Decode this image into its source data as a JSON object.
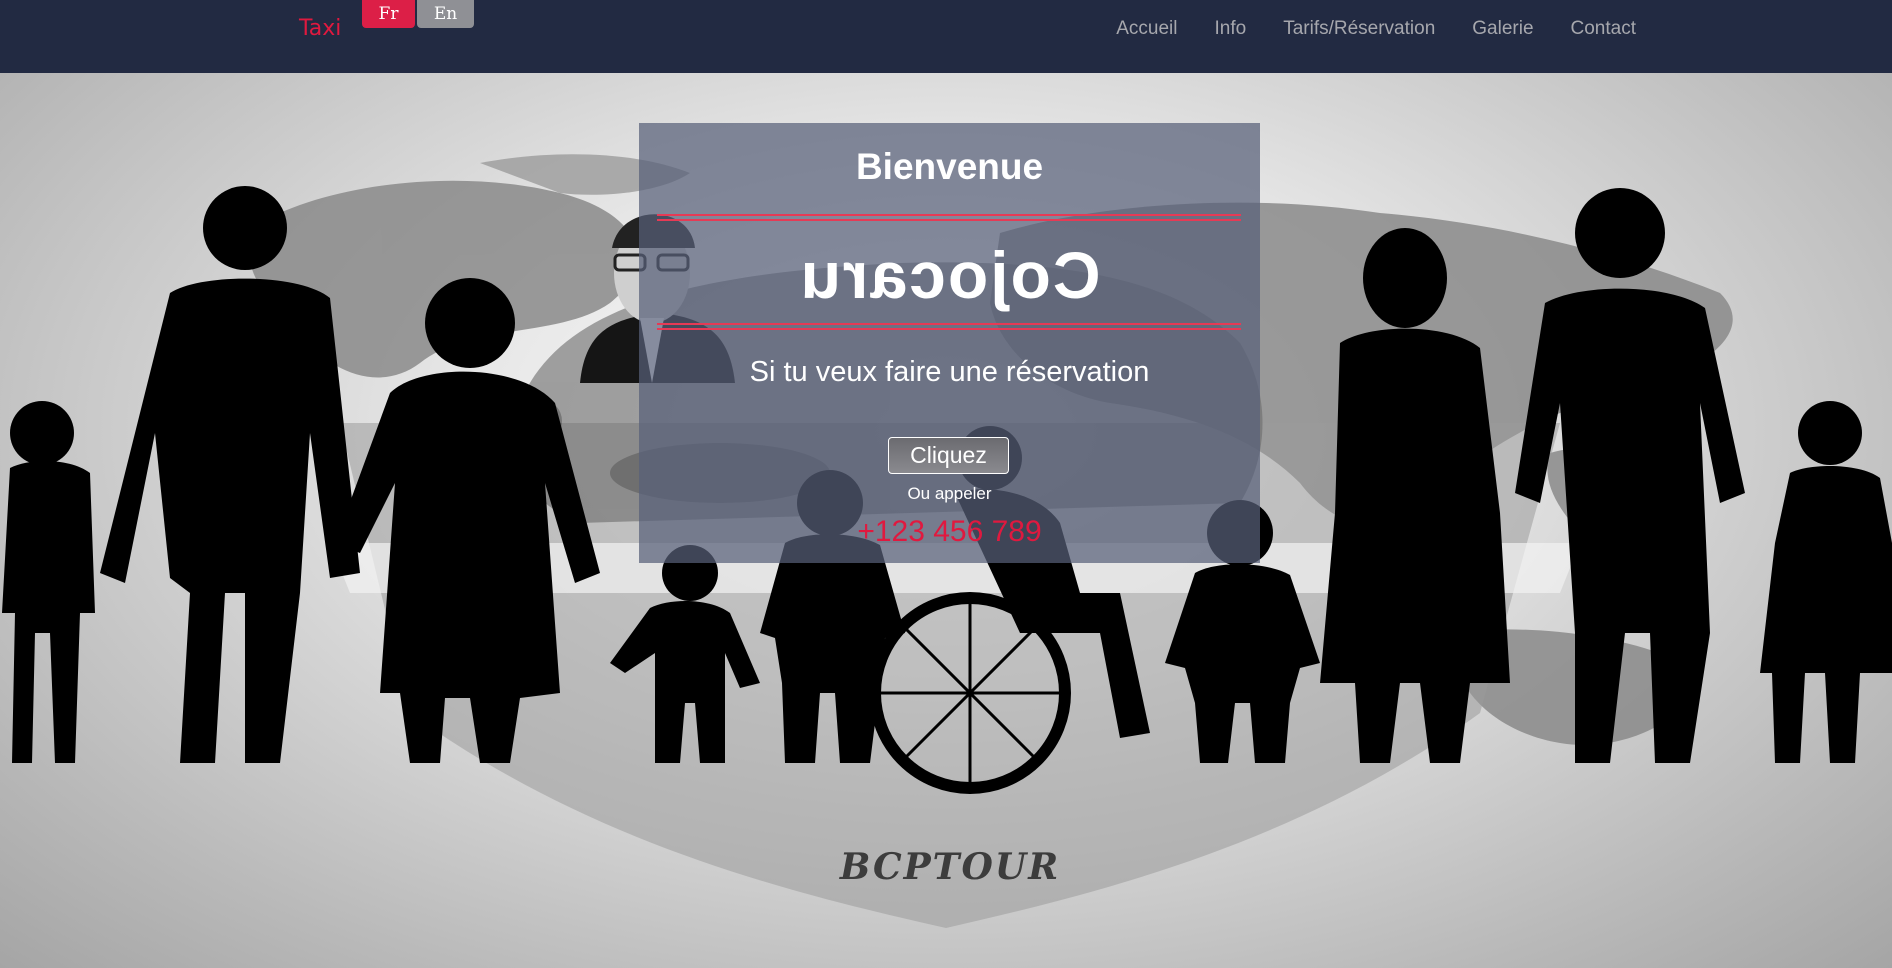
{
  "nav": {
    "brand": "Taxi",
    "languages": {
      "fr": "Fr",
      "en": "En",
      "active": "Fr"
    },
    "links": [
      "Accueil",
      "Info",
      "Tarifs/Réservation",
      "Galerie",
      "Contact"
    ]
  },
  "hero": {
    "welcome": "Bienvenue",
    "brand_name": "Cojocaru",
    "reserve_text": "Si tu veux faire une réservation",
    "cta_label": "Cliquez",
    "or_call": "Ou appeler",
    "phone": "+123 456 789",
    "logo_text": "BCPTOUR"
  },
  "colors": {
    "navbar": "#222a42",
    "accent": "#e0193f",
    "nav_link": "#a6a7ad",
    "lang_inactive": "#8f9095",
    "panel": "rgba(88,96,120,0.72)"
  },
  "icons": [
    "world-map-illustration",
    "family-silhouettes",
    "taxi-driver-illustration",
    "wheelchair-icon"
  ]
}
